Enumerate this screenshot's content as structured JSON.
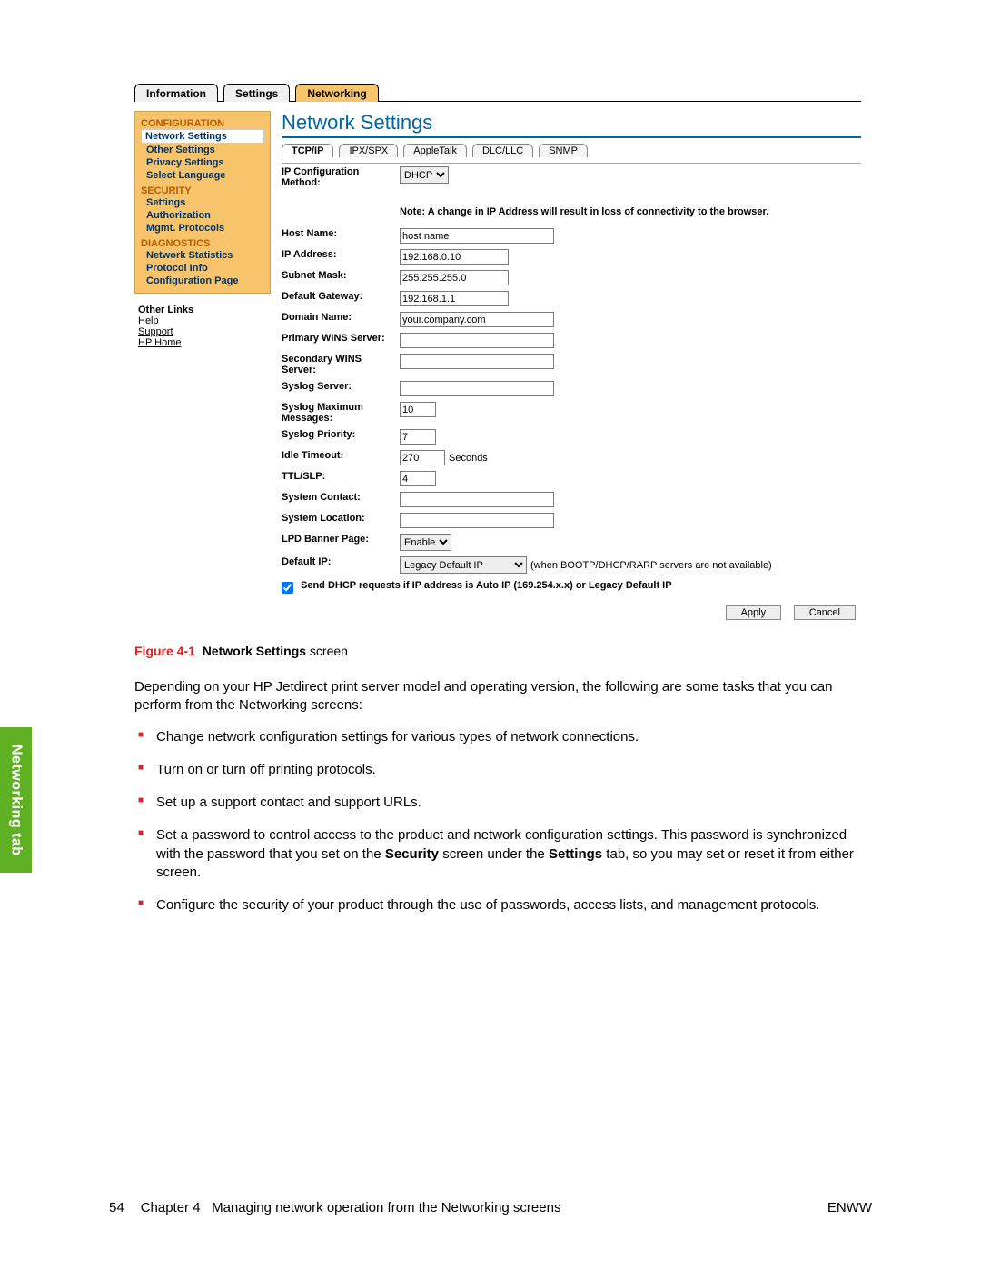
{
  "sideTab": "Networking tab",
  "topTabs": {
    "info": "Information",
    "settings": "Settings",
    "networking": "Networking"
  },
  "sidebar": {
    "configuration": {
      "header": "CONFIGURATION",
      "items": [
        "Network Settings",
        "Other Settings",
        "Privacy Settings",
        "Select Language"
      ]
    },
    "security": {
      "header": "SECURITY",
      "items": [
        "Settings",
        "Authorization",
        "Mgmt. Protocols"
      ]
    },
    "diagnostics": {
      "header": "DIAGNOSTICS",
      "items": [
        "Network Statistics",
        "Protocol Info",
        "Configuration Page"
      ]
    }
  },
  "otherLinks": {
    "title": "Other Links",
    "links": [
      "Help",
      "Support",
      "HP Home"
    ]
  },
  "main": {
    "title": "Network Settings",
    "subtabs": [
      "TCP/IP",
      "IPX/SPX",
      "AppleTalk",
      "DLC/LLC",
      "SNMP"
    ],
    "fields": {
      "ipConfigMethod": {
        "label": "IP Configuration Method:",
        "value": "DHCP"
      },
      "note": "Note: A change in IP Address will result in loss of connectivity to the browser.",
      "hostName": {
        "label": "Host Name:",
        "value": "host name"
      },
      "ipAddress": {
        "label": "IP Address:",
        "value": "192.168.0.10"
      },
      "subnetMask": {
        "label": "Subnet Mask:",
        "value": "255.255.255.0"
      },
      "defaultGateway": {
        "label": "Default Gateway:",
        "value": "192.168.1.1"
      },
      "domainName": {
        "label": "Domain Name:",
        "value": "your.company.com"
      },
      "primaryWins": {
        "label": "Primary WINS Server:",
        "value": ""
      },
      "secondaryWins": {
        "label": "Secondary WINS Server:",
        "value": ""
      },
      "syslogServer": {
        "label": "Syslog Server:",
        "value": ""
      },
      "syslogMax": {
        "label": "Syslog Maximum Messages:",
        "value": "10"
      },
      "syslogPriority": {
        "label": "Syslog Priority:",
        "value": "7"
      },
      "idleTimeout": {
        "label": "Idle Timeout:",
        "value": "270",
        "unit": "Seconds"
      },
      "ttlSlp": {
        "label": "TTL/SLP:",
        "value": "4"
      },
      "systemContact": {
        "label": "System Contact:",
        "value": ""
      },
      "systemLocation": {
        "label": "System Location:",
        "value": ""
      },
      "lpdBanner": {
        "label": "LPD Banner Page:",
        "value": "Enable"
      },
      "defaultIp": {
        "label": "Default IP:",
        "value": "Legacy Default IP",
        "suffix": "(when BOOTP/DHCP/RARP servers are not available)"
      },
      "dhcpCheck": "Send DHCP requests if IP address is Auto IP (169.254.x.x) or Legacy Default IP"
    },
    "buttons": {
      "apply": "Apply",
      "cancel": "Cancel"
    }
  },
  "caption": {
    "fignum": "Figure 4-1",
    "bold": "Network Settings",
    "rest": " screen"
  },
  "bodyIntro": "Depending on your HP Jetdirect print server model and operating version, the following are some tasks that you can perform from the Networking screens:",
  "bullets": [
    "Change network configuration settings for various types of network connections.",
    "Turn on or turn off printing protocols.",
    "Set up a support contact and support URLs.",
    "Set a password to control access to the product and network configuration settings. This password is synchronized with the password that you set on the <b>Security</b> screen under the <b>Settings</b> tab, so you may set or reset it from either screen.",
    "Configure the security of your product through the use of passwords, access lists, and management protocols."
  ],
  "footer": {
    "page": "54",
    "chapter": "Chapter 4",
    "title": "Managing network operation from the Networking screens",
    "right": "ENWW"
  }
}
